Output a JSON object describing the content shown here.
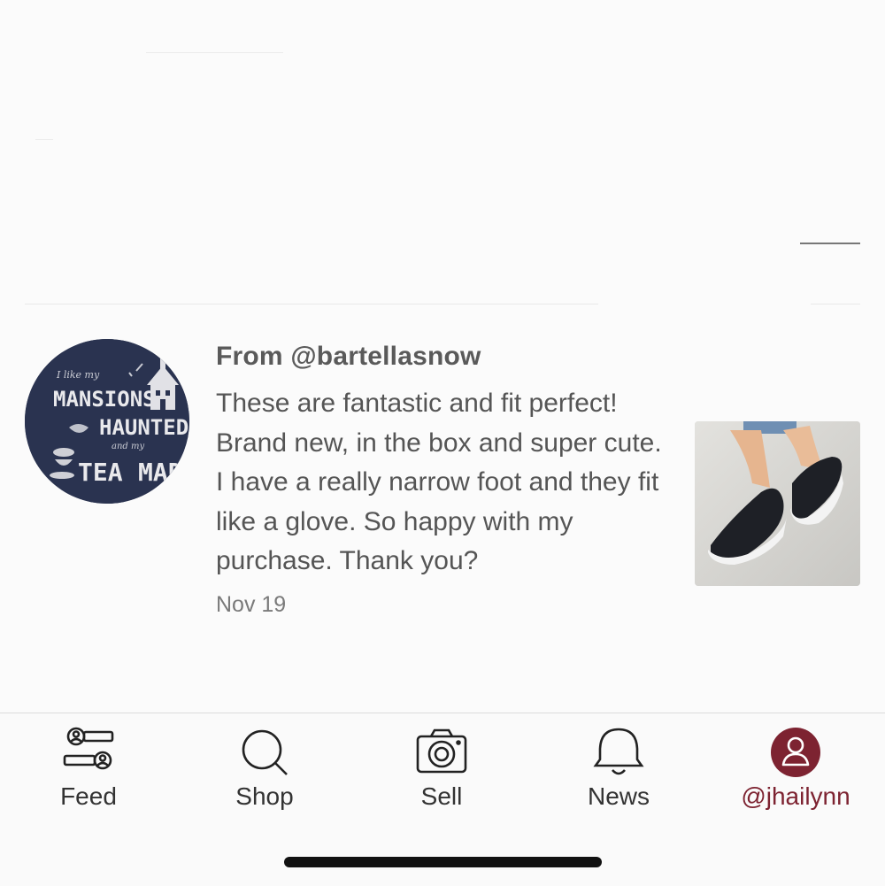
{
  "review": {
    "from": "From @bartellasnow",
    "text": "These are fantastic and fit perfect! Brand new, in the box and super cute. I have a really narrow foot and they fit like a glove. So happy with my purchase. Thank you?",
    "date": "Nov 19",
    "avatar_text": [
      "I like my",
      "MANSIONS",
      "HAUNTED",
      "and my",
      "TEA",
      "MAD"
    ]
  },
  "tabbar": {
    "tabs": [
      {
        "label": "Feed",
        "icon": "feed-icon"
      },
      {
        "label": "Shop",
        "icon": "search-icon"
      },
      {
        "label": "Sell",
        "icon": "camera-icon"
      },
      {
        "label": "News",
        "icon": "bell-icon"
      },
      {
        "label": "@jhailynn",
        "icon": "profile-icon",
        "active": true
      }
    ]
  },
  "colors": {
    "accent": "#7d2331",
    "text": "#555555",
    "background": "#fbfbfb"
  }
}
